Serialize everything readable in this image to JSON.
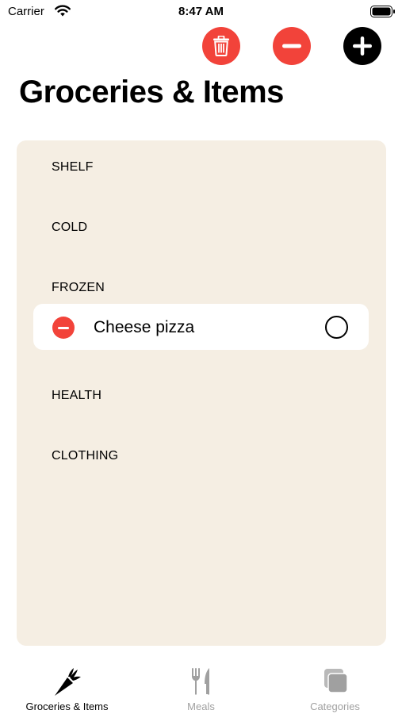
{
  "status_bar": {
    "carrier": "Carrier",
    "time": "8:47 AM"
  },
  "toolbar": {
    "trash_icon": "trash-icon",
    "remove_icon": "minus-circle-icon",
    "add_icon": "plus-circle-icon"
  },
  "page": {
    "title": "Groceries & Items"
  },
  "list": {
    "sections": [
      "SHELF",
      "COLD",
      "FROZEN",
      "HEALTH",
      "CLOTHING"
    ],
    "items": [
      {
        "label": "Cheese pizza",
        "section": "FROZEN",
        "checked": false
      }
    ]
  },
  "tab_bar": {
    "tabs": [
      {
        "label": "Groceries & Items",
        "icon": "carrot-icon",
        "active": true
      },
      {
        "label": "Meals",
        "icon": "fork-knife-icon",
        "active": false
      },
      {
        "label": "Categories",
        "icon": "stack-icon",
        "active": false
      }
    ]
  },
  "colors": {
    "accent_red": "#f2433a",
    "card_background": "#f5eee3",
    "inactive_gray": "#a0a0a0"
  }
}
